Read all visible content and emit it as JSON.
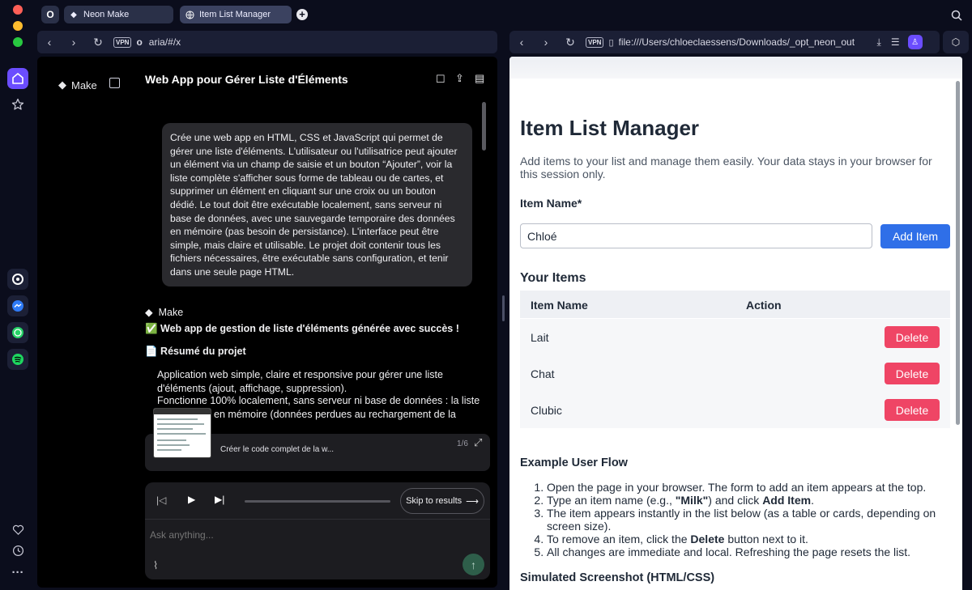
{
  "colors": {
    "window_bg": "#0b0d1c",
    "accent_purple": "#6b4dff",
    "primary_blue": "#2f6fe8",
    "delete_red": "#ef4565"
  },
  "rail": {
    "icons": [
      "home-icon",
      "star-icon",
      "openai-icon",
      "messenger-icon",
      "whatsapp-icon",
      "spotify-icon",
      "heart-icon",
      "clock-icon",
      "more-icon"
    ]
  },
  "tabs": [
    {
      "label": "Neon Make",
      "icon": "neon-make-icon"
    },
    {
      "label": "Item List Manager",
      "icon": "globe-icon"
    }
  ],
  "left_address": {
    "url": "aria/#/x",
    "vpn": "VPN"
  },
  "right_address": {
    "url": "file:///Users/chloeclaessens/Downloads/_opt_neon_out",
    "vpn": "VPN"
  },
  "chat": {
    "brand": "Make",
    "title": "Web App pour Gérer Liste d'Éléments",
    "user_message": "Crée une web app en HTML, CSS et JavaScript qui permet de gérer une liste d'éléments. L'utilisateur ou l'utilisatrice peut ajouter un élément via un champ de saisie et un bouton “Ajouter”, voir la liste complète s'afficher sous forme de tableau ou de cartes, et supprimer un élément en cliquant sur une croix ou un bouton dédié. Le tout doit être exécutable localement, sans serveur ni base de données, avec une sauvegarde temporaire des données en mémoire (pas besoin de persistance). L'interface peut être simple, mais claire et utilisable. Le projet doit contenir tous les fichiers nécessaires, être exécutable sans configuration, et tenir dans une seule page HTML.",
    "response_author": "Make",
    "success_line": "✅ Web app de gestion de liste d'éléments générée avec succès !",
    "summary_heading": "📄 Résumé du projet",
    "summary_p1": "Application web simple, claire et responsive pour gérer une liste d'éléments (ajout, affichage, suppression).",
    "summary_p2": "Fonctionne 100% localement, sans serveur ni base de données : la liste",
    "summary_p3": "en mémoire (données perdues au rechargement de la",
    "task_label": "Créer le code complet de la w...",
    "task_counter": "1/6",
    "skip_label": "Skip to results",
    "input_placeholder": "Ask anything..."
  },
  "page": {
    "title": "Item List Manager",
    "intro": "Add items to your list and manage them easily. Your data stays in your browser for this session only.",
    "field_label": "Item Name*",
    "field_value": "Chloé",
    "add_button": "Add Item",
    "list_heading": "Your Items",
    "col_name": "Item Name",
    "col_action": "Action",
    "items": [
      "Lait",
      "Chat",
      "Clubic"
    ],
    "delete_label": "Delete",
    "flow_heading": "Example User Flow",
    "flow_1": "Open the page in your browser. The form to add an item appears at the top.",
    "flow_2a": "Type an item name (e.g., ",
    "flow_2b": "\"Milk\"",
    "flow_2c": ") and click ",
    "flow_2d": "Add Item",
    "flow_2e": ".",
    "flow_3": "The item appears instantly in the list below (as a table or cards, depending on screen size).",
    "flow_4a": "To remove an item, click the ",
    "flow_4b": "Delete",
    "flow_4c": " button next to it.",
    "flow_5": "All changes are immediate and local. Refreshing the page resets the list.",
    "sim_heading": "Simulated Screenshot (HTML/CSS)"
  }
}
